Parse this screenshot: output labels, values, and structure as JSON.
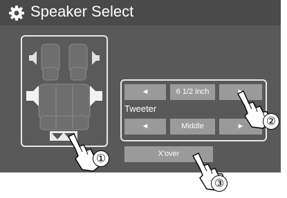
{
  "header": {
    "title": "Speaker Select",
    "icon": "gear-icon"
  },
  "speaker_panel": {
    "speaker_size": {
      "prev_symbol": "◄",
      "value": "6 1/2 inch",
      "next_symbol": "►"
    },
    "speaker_name": "Tweeter",
    "crossover_position": {
      "prev_symbol": "◄",
      "value": "Middle",
      "next_symbol": "►"
    }
  },
  "xover_button": {
    "label": "X'over"
  },
  "callouts": [
    "①",
    "②",
    "③"
  ],
  "colors": {
    "screen_bg": "#595959",
    "button_bg": "#9a9a9a",
    "frame": "#e8e8e8"
  }
}
